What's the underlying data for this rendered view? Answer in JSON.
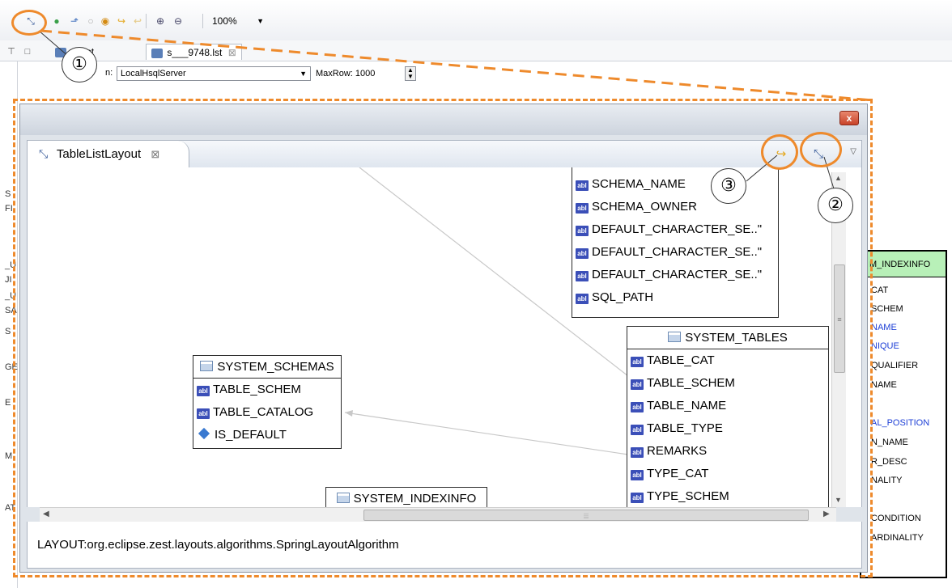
{
  "toolbar": {
    "zoom": "100%",
    "icons": [
      "layout-graph-icon",
      "refresh-icon",
      "export-icon",
      "circle-icon",
      "record-icon",
      "forward-icon",
      "back-icon",
      "zoom-in-icon",
      "zoom-out-icon"
    ]
  },
  "editor_tabs": [
    {
      "label": "15.lst"
    },
    {
      "label": "s___9748.lst"
    }
  ],
  "connection": {
    "prefix": "n:",
    "value": "LocalHsqlServer",
    "maxrow_label": "MaxRow: 1000"
  },
  "left_strip": [
    "S",
    "FI",
    "_U",
    "JI",
    "_U",
    "SA",
    "S",
    "GE",
    "E",
    "M",
    "AT"
  ],
  "background_table": {
    "header": "M_INDEXINFO",
    "rows": [
      {
        "text": "CAT",
        "blue": false
      },
      {
        "text": "SCHEM",
        "blue": false
      },
      {
        "text": "NAME",
        "blue": true
      },
      {
        "text": "NIQUE",
        "blue": true
      },
      {
        "text": "QUALIFIER",
        "blue": false
      },
      {
        "text": "NAME",
        "blue": false
      },
      {
        "text": "AL_POSITION",
        "blue": true
      },
      {
        "text": "N_NAME",
        "blue": false
      },
      {
        "text": "R_DESC",
        "blue": false
      },
      {
        "text": "NALITY",
        "blue": false
      },
      {
        "text": "CONDITION",
        "blue": false
      },
      {
        "text": "ARDINALITY",
        "blue": false
      }
    ]
  },
  "dialog": {
    "close_label": "x",
    "view_tab": {
      "label": "TableListLayout",
      "close": "⊠"
    },
    "status": "LAYOUT:org.eclipse.zest.layouts.algorithms.SpringLayoutAlgorithm"
  },
  "entities": {
    "schemata": {
      "rows": [
        "SCHEMA_NAME",
        "SCHEMA_OWNER",
        "DEFAULT_CHARACTER_SE..\"",
        "DEFAULT_CHARACTER_SE..\"",
        "DEFAULT_CHARACTER_SE..\"",
        "SQL_PATH"
      ]
    },
    "system_schemas": {
      "title": "SYSTEM_SCHEMAS",
      "rows": [
        "TABLE_SCHEM",
        "TABLE_CATALOG"
      ],
      "key_row": "IS_DEFAULT"
    },
    "system_tables": {
      "title": "SYSTEM_TABLES",
      "rows": [
        "TABLE_CAT",
        "TABLE_SCHEM",
        "TABLE_NAME",
        "TABLE_TYPE",
        "REMARKS",
        "TYPE_CAT",
        "TYPE_SCHEM"
      ]
    },
    "system_indexinfo": {
      "title": "SYSTEM_INDEXINFO"
    }
  },
  "annotations": {
    "n1": "①",
    "n2": "②",
    "n3": "③",
    "accent": "#ee8a2c"
  }
}
